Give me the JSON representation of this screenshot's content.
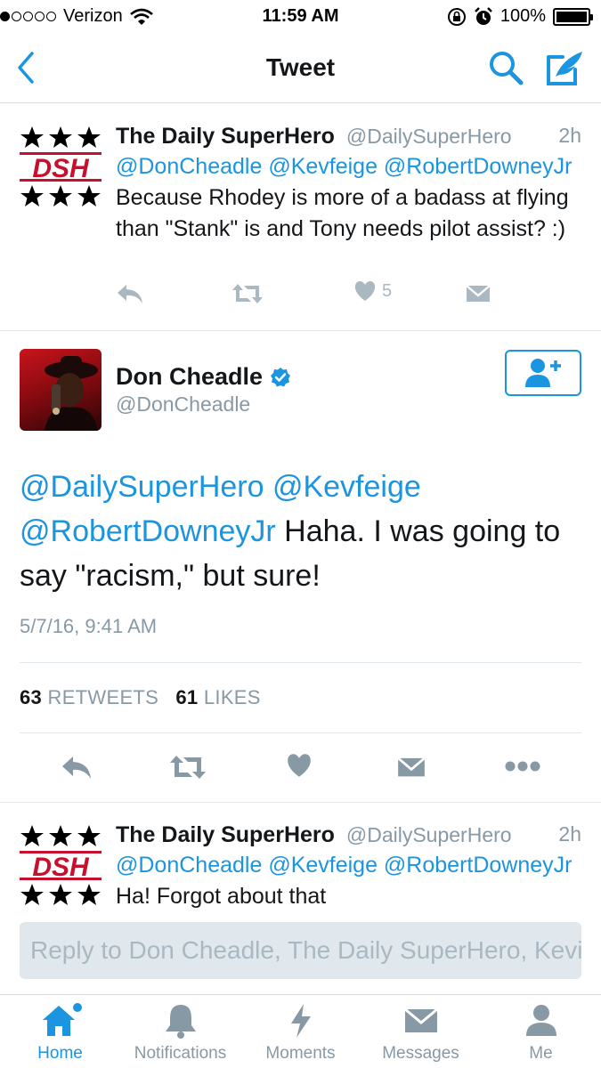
{
  "status_bar": {
    "carrier": "Verizon",
    "time": "11:59 AM",
    "battery": "100%",
    "signal_bars": 1
  },
  "nav": {
    "title": "Tweet",
    "back_icon": "chevron-left-icon",
    "search_icon": "search-icon",
    "compose_icon": "compose-icon"
  },
  "tweets_above": [
    {
      "name": "The Daily SuperHero",
      "handle": "@DailySuperHero",
      "time": "2h",
      "avatar_text": "DSH",
      "mentions": "@DonCheadle @Kevfeige @RobertDowneyJr",
      "text": " Because Rhodey is more of a badass at flying than \"Stank\" is and Tony needs pilot assist? :)",
      "likes": "5"
    }
  ],
  "main_tweet": {
    "name": "Don Cheadle",
    "handle": "@DonCheadle",
    "verified": true,
    "mentions": "@DailySuperHero @Kevfeige @RobertDowneyJr",
    "text": " Haha. I was going to say \"racism,\" but sure!",
    "date": "5/7/16, 9:41 AM",
    "retweet_count": "63",
    "retweet_label": "RETWEETS",
    "like_count": "61",
    "like_label": "LIKES"
  },
  "tweets_below": [
    {
      "name": "The Daily SuperHero",
      "handle": "@DailySuperHero",
      "time": "2h",
      "avatar_text": "DSH",
      "mentions": "@DonCheadle @Kevfeige @RobertDowneyJr",
      "text": " Ha! Forgot about that"
    }
  ],
  "reply": {
    "placeholder": "Reply to Don Cheadle, The Daily SuperHero, Kevin Feige"
  },
  "tabs": [
    {
      "label": "Home",
      "icon": "home-icon",
      "active": true
    },
    {
      "label": "Notifications",
      "icon": "bell-icon",
      "active": false
    },
    {
      "label": "Moments",
      "icon": "lightning-icon",
      "active": false
    },
    {
      "label": "Messages",
      "icon": "envelope-icon",
      "active": false
    },
    {
      "label": "Me",
      "icon": "person-icon",
      "active": false
    }
  ],
  "colors": {
    "accent": "#1b95e0",
    "muted": "#8899a6",
    "icon_gray": "#aab8c2",
    "dsh_red": "#c8102e"
  }
}
